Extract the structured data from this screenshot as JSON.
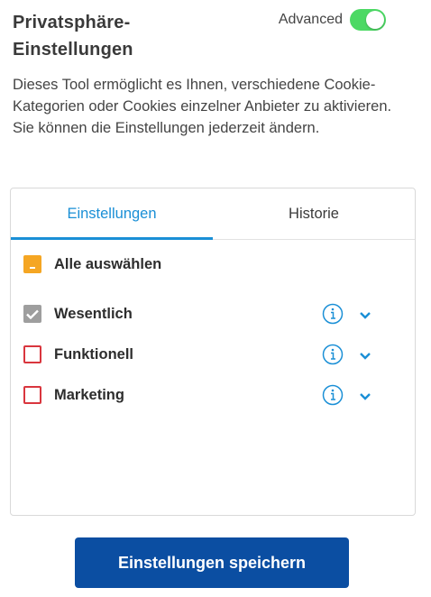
{
  "header": {
    "title": "Privatsphäre-Einstellungen",
    "advanced_label": "Advanced",
    "advanced_on": true
  },
  "description": "Dieses Tool ermöglicht es Ihnen, verschiedene Cookie-Kategorien oder Cookies einzelner Anbieter zu aktivieren. Sie können die Einstellungen jederzeit ändern.",
  "tabs": [
    {
      "label": "Einstellungen",
      "active": true
    },
    {
      "label": "Historie",
      "active": false
    }
  ],
  "select_all": {
    "label": "Alle auswählen",
    "state": "partial"
  },
  "categories": [
    {
      "label": "Wesentlich",
      "state": "checked"
    },
    {
      "label": "Funktionell",
      "state": "unchecked"
    },
    {
      "label": "Marketing",
      "state": "unchecked"
    }
  ],
  "save_button": "Einstellungen speichern",
  "colors": {
    "accent": "#1a8fd6",
    "toggle_on": "#4cd964",
    "partial": "#f5a623",
    "unchecked_border": "#d9363e",
    "checked_disabled": "#9e9e9e",
    "button": "#0b4ea2"
  }
}
